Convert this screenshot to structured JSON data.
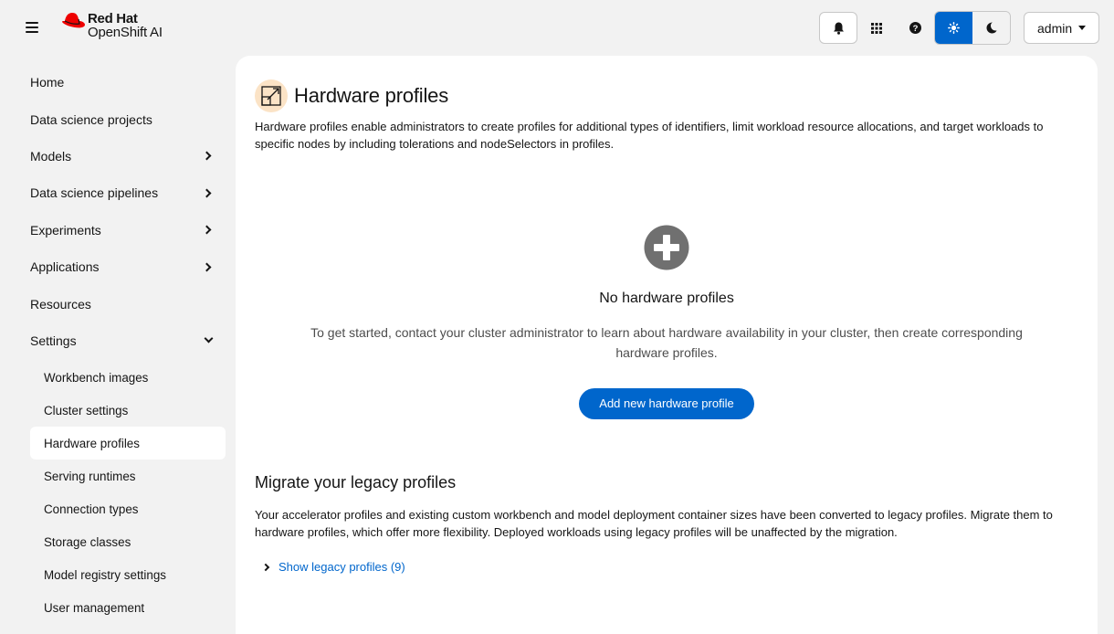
{
  "brand": {
    "line1": "Red Hat",
    "line2": "OpenShift AI",
    "hat_color": "#ee0000"
  },
  "masthead": {
    "icons": [
      "bell-icon",
      "app-launcher-icon",
      "help-icon",
      "sun-icon",
      "moon-icon"
    ],
    "user": "admin"
  },
  "sidebar": {
    "items": [
      {
        "label": "Home",
        "expandable": false
      },
      {
        "label": "Data science projects",
        "expandable": false
      },
      {
        "label": "Models",
        "expandable": true
      },
      {
        "label": "Data science pipelines",
        "expandable": true
      },
      {
        "label": "Experiments",
        "expandable": true
      },
      {
        "label": "Applications",
        "expandable": true
      },
      {
        "label": "Resources",
        "expandable": false
      },
      {
        "label": "Settings",
        "expanded": true
      }
    ],
    "settings_children": [
      "Workbench images",
      "Cluster settings",
      "Hardware profiles",
      "Serving runtimes",
      "Connection types",
      "Storage classes",
      "Model registry settings",
      "User management"
    ],
    "active": "Hardware profiles"
  },
  "page": {
    "title": "Hardware profiles",
    "description": "Hardware profiles enable administrators to create profiles for additional types of identifiers, limit workload resource allocations, and target workloads to specific nodes by including tolerations and nodeSelectors in profiles.",
    "empty_title": "No hardware profiles",
    "empty_body": "To get started, contact your cluster administrator to learn about hardware availability in your cluster, then create corresponding hardware profiles.",
    "add_button": "Add new hardware profile",
    "migrate_title": "Migrate your legacy profiles",
    "migrate_desc": "Your accelerator profiles and existing custom workbench and model deployment container sizes have been converted to legacy profiles. Migrate them to hardware profiles, which offer more flexibility. Deployed workloads using legacy profiles will be unaffected by the migration.",
    "show_legacy": "Show legacy profiles (9)"
  },
  "colors": {
    "accent": "#0066cc",
    "icon_bg": "#fbe3c6",
    "page_bg": "#f2f2f2"
  }
}
